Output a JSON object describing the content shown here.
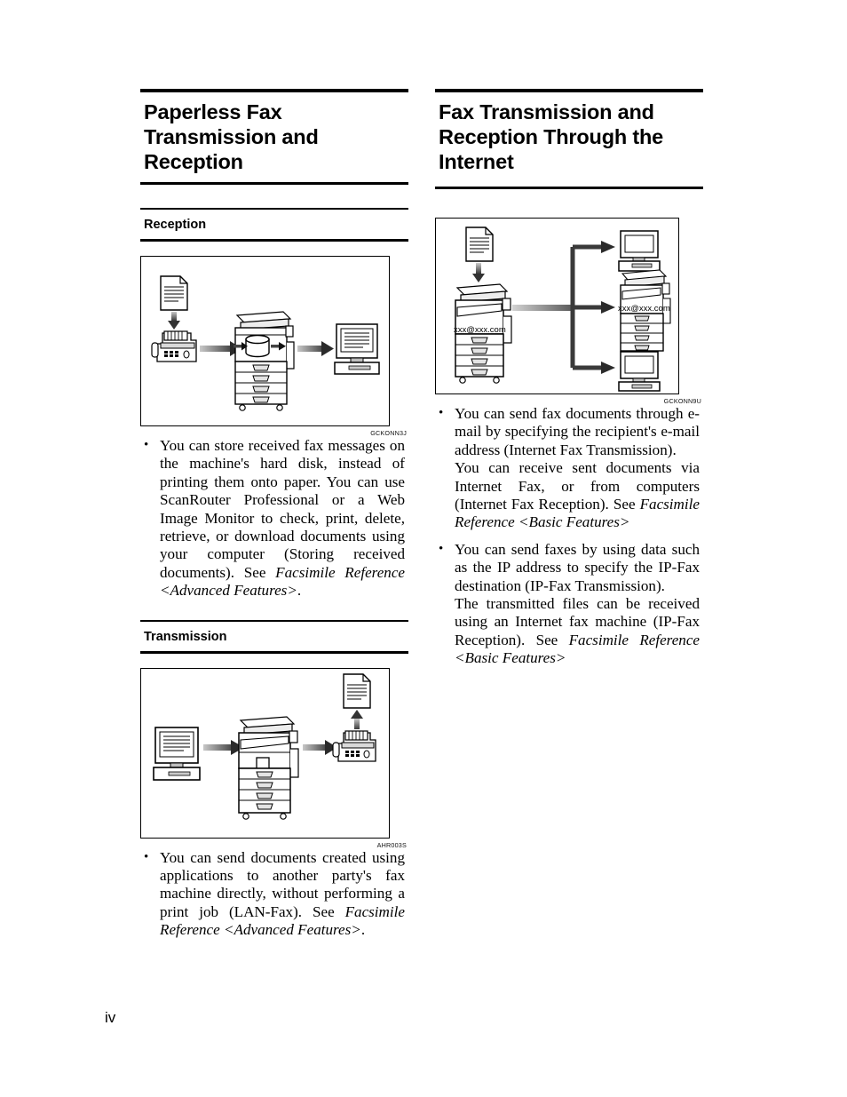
{
  "page": {
    "folio": "iv"
  },
  "left_column": {
    "chapter_title": "Paperless Fax Transmission and Reception",
    "sections": [
      {
        "title": "Reception",
        "figure": {
          "caption_id": "GCKONN3J",
          "alt": "Document feeds into a fax machine, which sends to a multifunction printer storing data on its hard disk, which is then accessed by a computer"
        },
        "bullets": [
          {
            "paragraphs": [
              {
                "runs": [
                  {
                    "text": "You can store received fax messages on the machine's hard disk, instead of printing them onto paper. You can use ScanRouter Professional or a Web Image Monitor to check, print, delete, retrieve, or download documents using your computer (Storing received documents). See ",
                    "style": "normal"
                  },
                  {
                    "text": "Facsimile Reference <Advanced Features>",
                    "style": "italic"
                  },
                  {
                    "text": ".",
                    "style": "normal"
                  }
                ]
              }
            ]
          }
        ]
      },
      {
        "title": "Transmission",
        "figure": {
          "caption_id": "AHR003S",
          "alt": "A computer sends data to a multifunction printer, which transmits to a fax machine that prints a document"
        },
        "bullets": [
          {
            "paragraphs": [
              {
                "runs": [
                  {
                    "text": "You can send documents created using applications to another party's fax machine directly, without performing a print job (LAN-Fax). See ",
                    "style": "normal"
                  },
                  {
                    "text": "Facsimile Reference <Advanced Features>",
                    "style": "italic"
                  },
                  {
                    "text": ".",
                    "style": "normal"
                  }
                ]
              }
            ]
          }
        ]
      }
    ]
  },
  "right_column": {
    "chapter_title": "Fax Transmission and Reception Through the Internet",
    "figure": {
      "caption_id": "GCKONN9U",
      "email_label_sender": "xxx@xxx.com",
      "email_label_receiver": "xxx@xxx.com",
      "alt": "A document is scanned by a multifunction printer labelled with an e-mail address and distributed over the Internet to a computer, another multifunction printer, and a second computer"
    },
    "bullets": [
      {
        "paragraphs": [
          {
            "runs": [
              {
                "text": "You can send fax documents through e-mail by specifying the recipient's e-mail address (Internet Fax Transmission).",
                "style": "normal"
              }
            ]
          },
          {
            "runs": [
              {
                "text": "You can receive sent documents via Internet Fax, or from computers (Internet Fax Reception). See ",
                "style": "normal"
              },
              {
                "text": "Facsimile Reference <Basic Features>",
                "style": "italic"
              }
            ]
          }
        ]
      },
      {
        "paragraphs": [
          {
            "runs": [
              {
                "text": "You can send faxes by using data such as the IP address to specify the IP-Fax destination (IP-Fax Transmission).",
                "style": "normal"
              }
            ]
          },
          {
            "runs": [
              {
                "text": "The transmitted files can be received using an Internet fax machine (IP-Fax Reception). See ",
                "style": "normal"
              },
              {
                "text": "Facsimile Reference <Basic Features>",
                "style": "italic"
              }
            ]
          }
        ]
      }
    ]
  }
}
